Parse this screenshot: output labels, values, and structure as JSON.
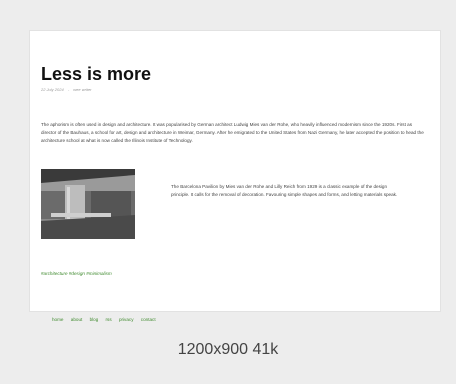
{
  "article": {
    "title": "Less is more",
    "date": "22 July 2024",
    "separator": "-",
    "author": "wee writer",
    "paragraph": "The aphorism is often used in design and architecture. It was popularised by German architect Ludwig Mies van der Rohe, who heavily influenced modernism since the 1920s. First as director of the Bauhaus, a school for art, design and architecture in Weimar, Germany. After he emigrated to the United States from Nazi Germany, he later accepted the position to head the architecture school at what is now called the Illinois Institute of Technology.",
    "image_caption": "The Barcelona Pavilion by Mies van der Rohe and Lilly Reich from 1929 is a classic example of the design principle. It calls for the removal of decoration. Favouring simple shapes and forms, and letting materials speak.",
    "tags": "#architecture #design #minimalism"
  },
  "footer": {
    "links": [
      "home",
      "about",
      "blog",
      "rss",
      "privacy",
      "contact"
    ]
  },
  "thumbnail": {
    "dimensions": "1200x900",
    "size": "41k",
    "label": "1200x900 41k"
  },
  "colors": {
    "link": "#3f8a2e",
    "background": "#ededed",
    "card": "#ffffff"
  }
}
